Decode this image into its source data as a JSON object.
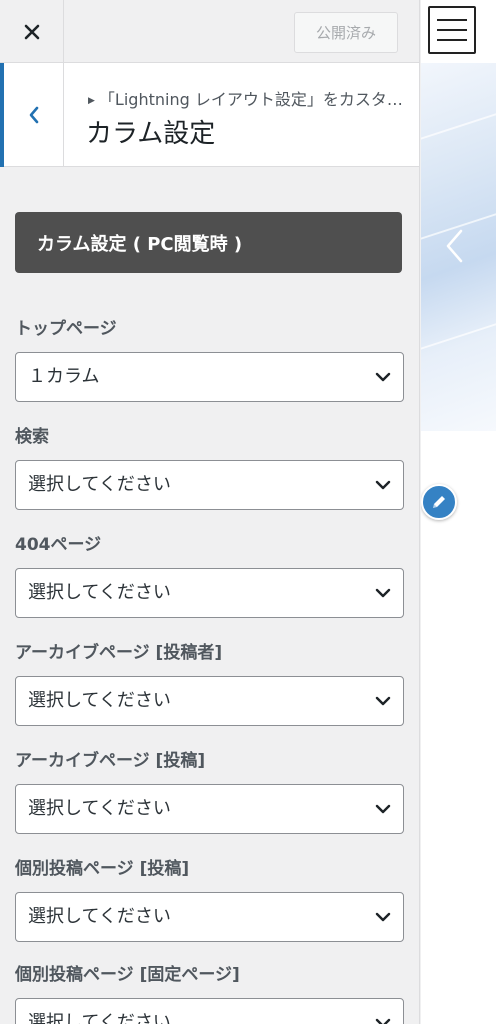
{
  "header": {
    "close_label": "×",
    "publish_label": "公開済み"
  },
  "section": {
    "breadcrumb": "「Lightning レイアウト設定」をカスタマイズ中",
    "title": "カラム設定"
  },
  "group": {
    "title": "カラム設定 ( PC閲覧時 )"
  },
  "fields": [
    {
      "label": "トップページ",
      "value": "１カラム"
    },
    {
      "label": "検索",
      "value": "選択してください"
    },
    {
      "label": "404ページ",
      "value": "選択してください"
    },
    {
      "label": "アーカイブページ [投稿者]",
      "value": "選択してください"
    },
    {
      "label": "アーカイブページ [投稿]",
      "value": "選択してください"
    },
    {
      "label": "個別投稿ページ [投稿]",
      "value": "選択してください"
    },
    {
      "label": "個別投稿ページ [固定ページ]",
      "value": "選択してください"
    }
  ],
  "icons": {
    "close": "close-icon",
    "back": "chevron-left-icon",
    "select": "chevron-down-icon",
    "menu": "hamburger-menu-icon",
    "slider_prev": "chevron-left-icon",
    "edit": "pencil-icon"
  },
  "colors": {
    "accent": "#2271b1",
    "banner": "#4f4f4f",
    "edit_button": "#3582c4"
  }
}
